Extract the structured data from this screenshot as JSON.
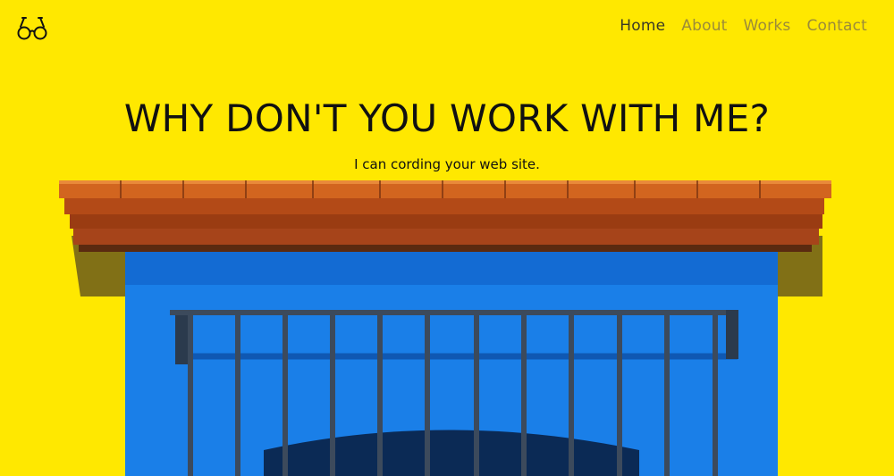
{
  "logo": {
    "icon": "glasses-icon"
  },
  "nav": {
    "items": [
      {
        "label": "Home",
        "active": true
      },
      {
        "label": "About",
        "active": false
      },
      {
        "label": "Works",
        "active": false
      },
      {
        "label": "Contact",
        "active": false
      }
    ]
  },
  "hero": {
    "headline": "WHY DON'T YOU WORK WITH ME?",
    "subheadline": "I can cording your web site."
  },
  "colors": {
    "background": "#ffe800",
    "wall_blue": "#1a7fe8",
    "roof_orange": "#c85a1a",
    "nav_active": "#3a3a26",
    "nav_inactive": "#9b8b39"
  }
}
